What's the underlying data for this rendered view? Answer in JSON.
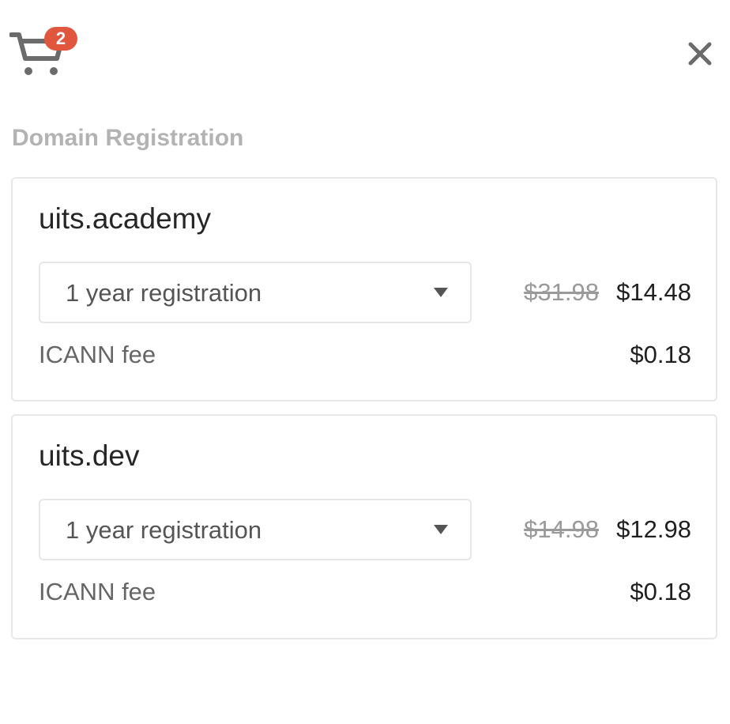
{
  "cart": {
    "count": "2",
    "icon": "cart-icon",
    "badge_color": "#e0573e"
  },
  "close": {
    "icon": "close-icon"
  },
  "section": {
    "title": "Domain Registration"
  },
  "items": [
    {
      "domain": "uits.academy",
      "term": "1 year registration",
      "old_price": "$31.98",
      "price": "$14.48",
      "fee_label": "ICANN fee",
      "fee_price": "$0.18"
    },
    {
      "domain": "uits.dev",
      "term": "1 year registration",
      "old_price": "$14.98",
      "price": "$12.98",
      "fee_label": "ICANN fee",
      "fee_price": "$0.18"
    }
  ]
}
